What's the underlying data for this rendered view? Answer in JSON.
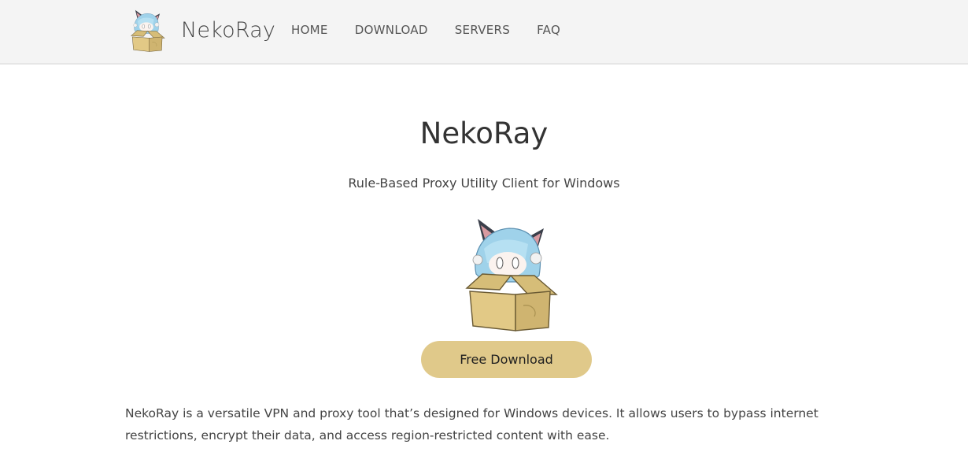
{
  "site": {
    "brand": "NekoRay",
    "logo_icon": "nekoray-mascot-logo-icon"
  },
  "nav": {
    "items": [
      {
        "label": "HOME"
      },
      {
        "label": "DOWNLOAD"
      },
      {
        "label": "SERVERS"
      },
      {
        "label": "FAQ"
      }
    ]
  },
  "hero": {
    "title": "NekoRay",
    "subtitle": "Rule-Based Proxy Utility Client for Windows",
    "mascot_icon": "nekoray-mascot-in-box-icon",
    "download_label": "Free Download"
  },
  "intro": {
    "text": "NekoRay is a versatile VPN and proxy tool that’s designed for Windows devices. It allows users to bypass internet restrictions, encrypt their data, and access region-restricted content with ease."
  },
  "colors": {
    "header_bg": "#f4f4f4",
    "button_bg": "#e0c98a",
    "text": "#333333"
  }
}
